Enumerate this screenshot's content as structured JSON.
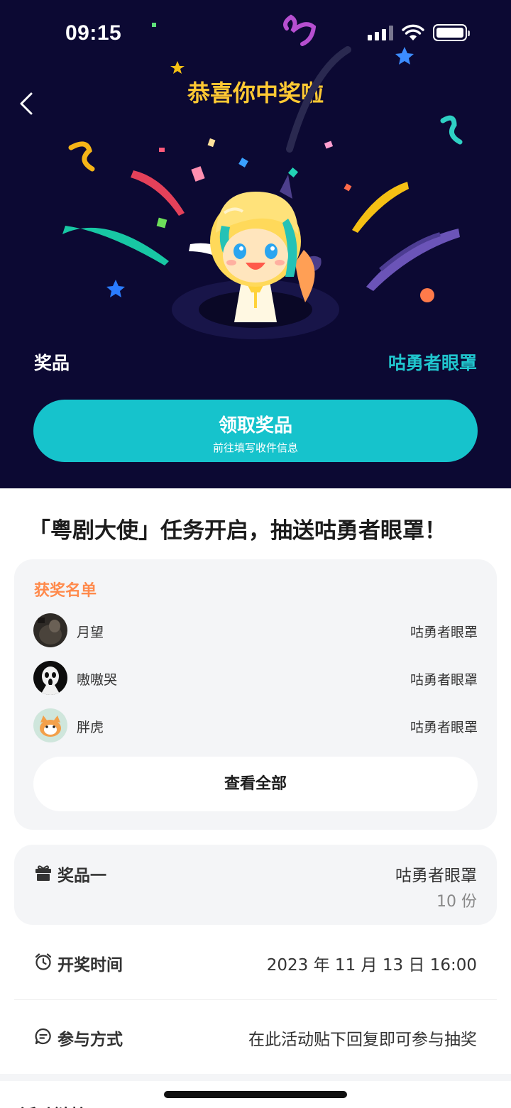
{
  "status_bar": {
    "time": "09:15"
  },
  "hero": {
    "title": "恭喜你中奖啦",
    "prize_label": "奖品",
    "prize_name": "咕勇者眼罩",
    "claim_button": {
      "label": "领取奖品",
      "sublabel": "前往填写收件信息"
    }
  },
  "headline": "「粤剧大使」任务开启，抽送咕勇者眼罩！",
  "winners": {
    "title": "获奖名单",
    "rows": [
      {
        "name": "月望",
        "prize": "咕勇者眼罩"
      },
      {
        "name": "嗷嗷哭",
        "prize": "咕勇者眼罩"
      },
      {
        "name": "胖虎",
        "prize": "咕勇者眼罩"
      }
    ],
    "view_all": "查看全部"
  },
  "prize_info": {
    "label": "奖品一",
    "name": "咕勇者眼罩",
    "quantity": "10 份"
  },
  "draw_time": {
    "label": "开奖时间",
    "value": "2023 年 11 月 13 日 16:00"
  },
  "participation": {
    "label": "参与方式",
    "value": "在此活动贴下回复即可参与抽奖"
  },
  "next_section": {
    "heading": "活动链接"
  },
  "colors": {
    "hero_bg": "#0c0933",
    "accent_teal": "#16c3cc",
    "title_gold": "#ffc933",
    "winners_title": "#ff8a4c"
  },
  "icons": [
    "back-icon",
    "signal-icon",
    "wifi-icon",
    "battery-icon",
    "gift-icon",
    "alarm-clock-icon",
    "chat-icon"
  ]
}
